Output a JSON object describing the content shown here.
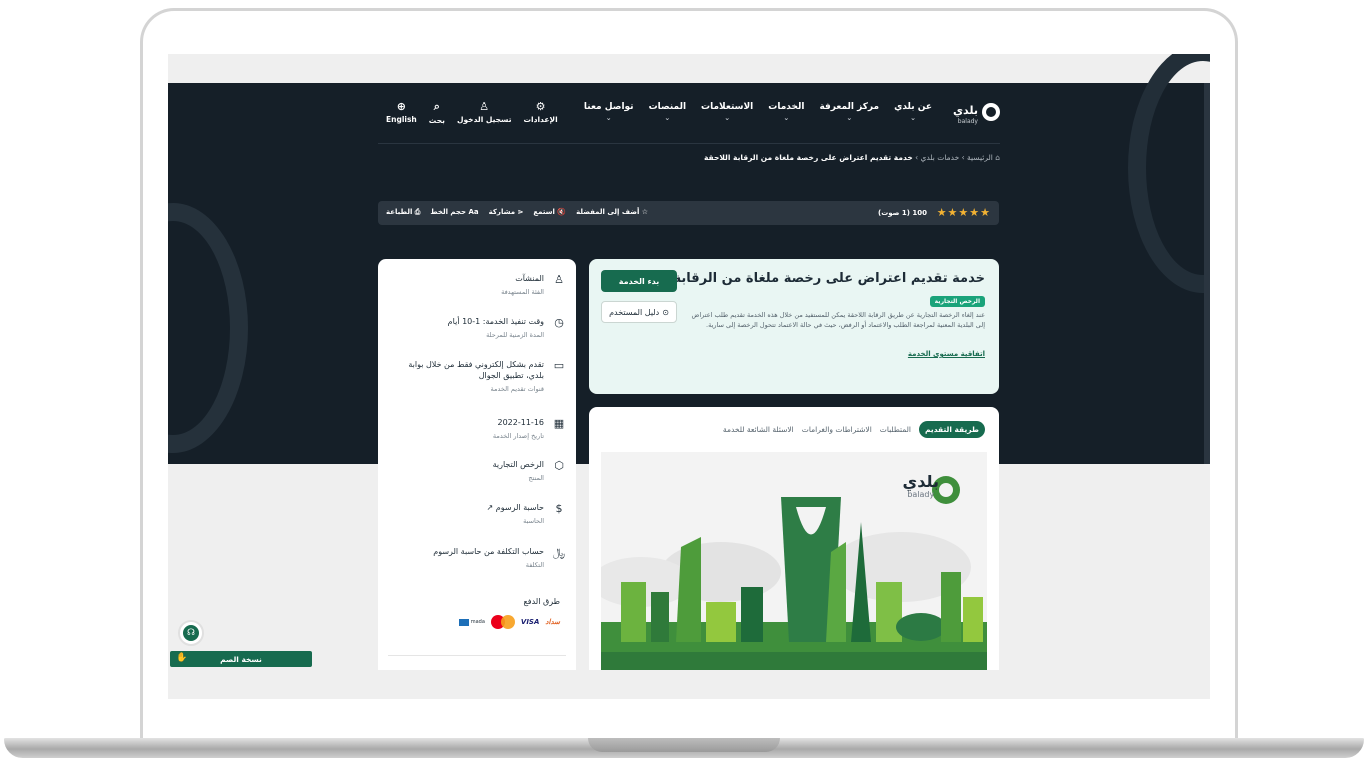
{
  "header": {
    "logo_text": "بلدي",
    "logo_sub": "balady",
    "nav": [
      "عن بلدي",
      "مركز المعرفة",
      "الخدمات",
      "الاستعلامات",
      "المنصات",
      "تواصل معنا"
    ],
    "tools": [
      {
        "icon": "globe-icon",
        "glyph": "⊕",
        "label": "English"
      },
      {
        "icon": "search-icon",
        "glyph": "⌕",
        "label": "بحث"
      },
      {
        "icon": "user-icon",
        "glyph": "♙",
        "label": "تسجيل الدخول"
      },
      {
        "icon": "gear-icon",
        "glyph": "⚙",
        "label": "الإعدادات"
      }
    ]
  },
  "breadcrumb": {
    "home": "الرئيسية",
    "section": "خدمات بلدي",
    "current": "خدمة تقديم اعتراض على رخصة ملغاة من الرقابة اللاحقة"
  },
  "rating": {
    "stars": "★★★★★",
    "text": "100 (1 صوت)",
    "actions": [
      "أضف إلى المفضلة",
      "استمع",
      "مشاركة",
      "حجم الخط",
      "الطباعة"
    ]
  },
  "service": {
    "title": "خدمة تقديم اعتراض على رخصة ملغاة من الرقابة اللاحقة",
    "start_label": "بدء الخدمة",
    "guide_label": "دليل المستخدم",
    "tag": "الرخص التجارية",
    "description": "عند إلغاء الرخصة التجارية عن طريق الرقابة اللاحقة يمكن للمستفيد من خلال هذه الخدمة تقديم طلب اعتراض إلى البلدية المعنية لمراجعة الطلب والاعتماد أو الرفض، حيث في حالة الاعتماد تتحول الرخصة إلى سارية.",
    "sla_link": "اتفاقية مستوى الخدمة"
  },
  "tabs": [
    "طريقة التقديم",
    "المتطلبات",
    "الاشتراطات والغرامات",
    "الاسئلة الشائعة للخدمة"
  ],
  "illustration": {
    "logo_text": "بلدي",
    "logo_sub": "balady"
  },
  "sidebar": {
    "items": [
      {
        "icon": "user-icon",
        "glyph": "♙",
        "value": "المنشآت",
        "label": "الفئة المستهدفة"
      },
      {
        "icon": "clock-icon",
        "glyph": "◷",
        "value": "وقت تنفيذ الخدمة: 1-10 أيام",
        "label": "المدة الزمنية للمرحلة"
      },
      {
        "icon": "monitor-icon",
        "glyph": "▭",
        "value": "تقدم بشكل إلكتروني فقط من خلال بوابة بلدي، تطبيق الجوال",
        "label": "قنوات تقديم الخدمة"
      },
      {
        "icon": "calendar-icon",
        "glyph": "▦",
        "value": "2022-11-16",
        "label": "تاريخ إصدار الخدمة"
      },
      {
        "icon": "box-icon",
        "glyph": "⬡",
        "value": "الرخص التجارية",
        "label": "المنتج"
      },
      {
        "icon": "dollar-icon",
        "glyph": "$",
        "value": "حاسبة الرسوم ↗",
        "label": "الحاسبة"
      },
      {
        "icon": "riyal-icon",
        "glyph": "﷼",
        "value": "حساب التكلفة من حاسبة الرسوم",
        "label": "التكلفة"
      }
    ],
    "payment_title": "طرق الدفع",
    "payments": [
      "سداد",
      "VISA",
      "mada"
    ]
  },
  "accessibility": {
    "deaf_label": "نسخة الصم"
  }
}
